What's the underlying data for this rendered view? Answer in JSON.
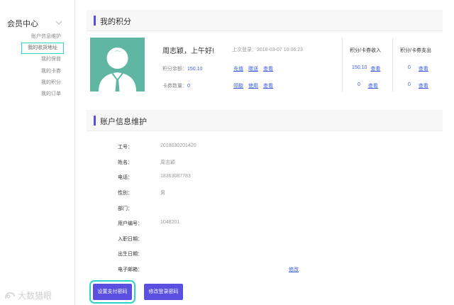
{
  "sidebar": {
    "title": "会员中心",
    "items": [
      {
        "label": "账户信息维护",
        "active": false
      },
      {
        "label": "我的收货地址",
        "active": true
      },
      {
        "label": "我的保普",
        "active": false
      },
      {
        "label": "我的卡券",
        "active": false
      },
      {
        "label": "我的积分",
        "active": false
      },
      {
        "label": "我的订单",
        "active": false
      }
    ]
  },
  "watermark": "大数猎眼",
  "points": {
    "section_title": "我的积分",
    "greeting": "周志颖，上午好!",
    "last_login_label": "上次登录：",
    "last_login_value": "2018-03-07 10:06:23",
    "balance_label": "积分余额：",
    "balance_value": "150.10",
    "balance_links": [
      "充值",
      "赠送",
      "查看"
    ],
    "cards_label": "卡券数量：",
    "cards_value": "0",
    "cards_links": [
      "领取",
      "使用",
      "查看"
    ],
    "income_header": "积分/卡券收入",
    "expense_header": "积分/卡券支出",
    "income_points": "150.10",
    "income_cards": "0",
    "expense_points": "0",
    "expense_cards": "0",
    "view_label": "查看"
  },
  "account": {
    "section_title": "账户信息维护",
    "fields": [
      {
        "label": "工号：",
        "value": "2018030201420"
      },
      {
        "label": "姓名：",
        "value": "周志颖"
      },
      {
        "label": "电话：",
        "value": "18363087783"
      },
      {
        "label": "性别：",
        "value": "男"
      },
      {
        "label": "部门：",
        "value": ""
      },
      {
        "label": "用户编号：",
        "value": "1048201"
      },
      {
        "label": "入职日期：",
        "value": ""
      },
      {
        "label": "出生日期：",
        "value": ""
      },
      {
        "label": "电子邮箱：",
        "value": ""
      }
    ],
    "edit_label": "修改",
    "set_pay_password": "设置支付密码",
    "change_login_password": "修改登录密码"
  },
  "colors": {
    "accent": "#5a4fe0",
    "link": "#3b5bdb",
    "avatar_bg": "#5fb7a3",
    "focus": "#2ad4c8"
  }
}
